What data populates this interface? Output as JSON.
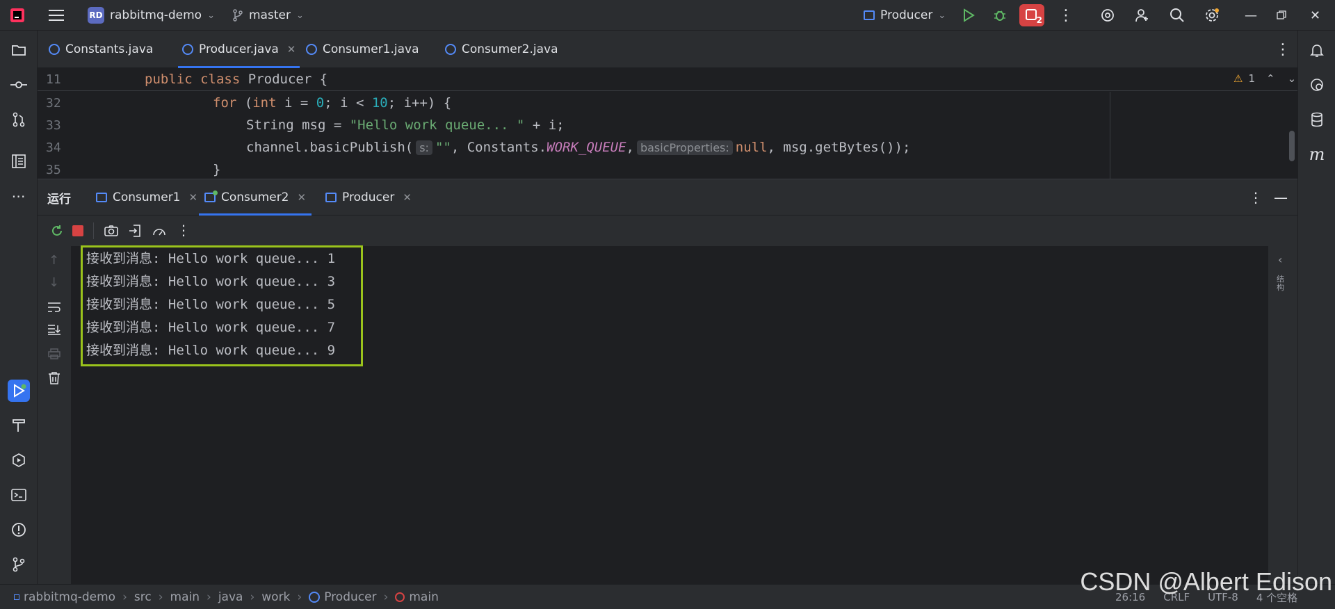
{
  "titlebar": {
    "project_badge": "RD",
    "project_name": "rabbitmq-demo",
    "branch": "master",
    "run_config": "Producer",
    "stop_badge_count": "2"
  },
  "editor_tabs": [
    {
      "label": "Constants.java",
      "active": false
    },
    {
      "label": "Producer.java",
      "active": true
    },
    {
      "label": "Consumer1.java",
      "active": false
    },
    {
      "label": "Consumer2.java",
      "active": false
    }
  ],
  "editor": {
    "warning_count": "1",
    "sticky": {
      "line": "11",
      "keyword1": "public",
      "keyword2": "class",
      "name": "Producer {"
    },
    "lines": [
      {
        "num": "32"
      },
      {
        "num": "33"
      },
      {
        "num": "34"
      },
      {
        "num": "35"
      }
    ],
    "line32": {
      "for": "for",
      "open": " (",
      "int": "int",
      "i1": " i = ",
      "zero": "0",
      "mid": "; i < ",
      "ten": "10",
      "end": "; i++) {"
    },
    "line33": {
      "pre": "String msg = ",
      "str": "\"Hello work queue... \"",
      "post": " + i;"
    },
    "line34": {
      "pre": "channel.basicPublish(",
      "hint_s": "s:",
      "str": "\"\"",
      "mid": ", Constants.",
      "const": "WORK_QUEUE",
      "comma": ",",
      "hint_bp": "basicProperties:",
      "null": "null",
      "post": ", msg.getBytes());"
    },
    "line35": {
      "brace": "}"
    }
  },
  "run_panel": {
    "title": "运行",
    "tabs": [
      {
        "label": "Consumer1",
        "active": false
      },
      {
        "label": "Consumer2",
        "active": true
      },
      {
        "label": "Producer",
        "active": false
      }
    ],
    "output": [
      "接收到消息: Hello work queue... 1",
      "接收到消息: Hello work queue... 3",
      "接收到消息: Hello work queue... 5",
      "接收到消息: Hello work queue... 7",
      "接收到消息: Hello work queue... 9"
    ],
    "right_label": "结构"
  },
  "statusbar": {
    "breadcrumbs": [
      "rabbitmq-demo",
      "src",
      "main",
      "java",
      "work",
      "Producer",
      "main"
    ],
    "position": "26:16",
    "line_sep": "CRLF",
    "encoding": "UTF-8",
    "indent": "4 个空格"
  },
  "watermark": "CSDN @Albert Edison",
  "colors": {
    "accent": "#3574f0",
    "highlight_border": "#9ac31c",
    "stop_button": "#d74343",
    "run_green": "#5fb865"
  }
}
